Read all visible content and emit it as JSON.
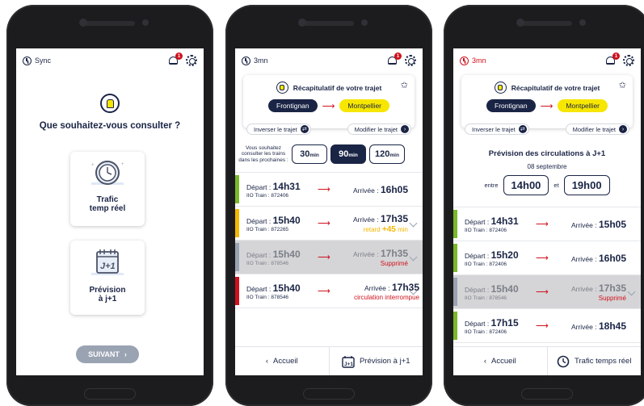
{
  "colors": {
    "navy": "#1a2445",
    "yellow": "#f7e600",
    "red": "#d0111d",
    "green": "#7ab929",
    "orange": "#f5b800",
    "grey": "#9aa3b2"
  },
  "screen1": {
    "sync_label": "Sync",
    "question": "Que souhaitez-vous consulter ?",
    "cards": [
      {
        "label": "Trafic\ntemp réel",
        "icon": "clock-icon"
      },
      {
        "label": "Prévision\nà j+1",
        "icon": "calendar-icon"
      }
    ],
    "calendar_text": "J+1",
    "next_button": "SUIVANT",
    "next_arrow": "›"
  },
  "screen2": {
    "refresh_label": "3mn",
    "recap_title": "Récapitulatif de votre trajet",
    "from": "Frontignan",
    "to": "Montpellier",
    "swap_label": "Inverser le trajet",
    "edit_label": "Modifier le trajet",
    "time_prompt": "Vous souhaitez consulter les trains dans les prochaines :",
    "time_options": [
      {
        "value": "30",
        "unit": "min"
      },
      {
        "value": "90",
        "unit": "min"
      },
      {
        "value": "120",
        "unit": "min"
      }
    ],
    "trains": [
      {
        "dep": "14h31",
        "train": "872406",
        "arr": "16h05",
        "status": "",
        "status_color": "",
        "bar": "#7ab929"
      },
      {
        "dep": "15h40",
        "train": "872265",
        "arr": "17h35",
        "status": "retard",
        "status_extra": "+45",
        "status_unit": "min",
        "status_color": "#f5b800",
        "bar": "#f5b800"
      },
      {
        "dep": "15h40",
        "train": "878546",
        "arr": "17h35",
        "status": "Supprimé",
        "status_color": "#d0111d",
        "bar": "#9aa3b2"
      },
      {
        "dep": "15h40",
        "train": "878546",
        "arr": "17h35",
        "status": "circulation interrompue",
        "status_color": "#d0111d",
        "bar": "#d0111d"
      }
    ],
    "bottom_left": "Accueil",
    "bottom_right": "Prévision à j+1",
    "calendar_text": "J+1"
  },
  "screen3": {
    "refresh_label": "3mn",
    "recap_title": "Récapitulatif de votre trajet",
    "from": "Frontignan",
    "to": "Montpellier",
    "swap_label": "Inverser le trajet",
    "edit_label": "Modifier le trajet",
    "forecast_title": "Prévision des circulations à J+1",
    "date": "08 septembre",
    "between": "entre",
    "and": "et",
    "start": "14h00",
    "end": "19h00",
    "trains": [
      {
        "dep": "14h31",
        "train": "872406",
        "arr": "15h05",
        "status": "",
        "bar": "#7ab929"
      },
      {
        "dep": "15h20",
        "train": "872406",
        "arr": "16h05",
        "status": "",
        "bar": "#7ab929"
      },
      {
        "dep": "15h40",
        "train": "878546",
        "arr": "17h35",
        "status": "Supprimé",
        "bar": "#9aa3b2"
      },
      {
        "dep": "17h15",
        "train": "872406",
        "arr": "18h45",
        "status": "",
        "bar": "#7ab929"
      }
    ],
    "bottom_left": "Accueil",
    "bottom_right": "Trafic temps réel"
  },
  "labels": {
    "depart": "Départ :",
    "arrivee": "Arrivée :",
    "train_no": "IIO Train :",
    "back_arrow": "‹",
    "route_arrow": "⟶",
    "row_arrow": "⟶",
    "swap_icon": "⇄",
    "next_icon": "›",
    "star": "✩",
    "notif_count": "1"
  }
}
